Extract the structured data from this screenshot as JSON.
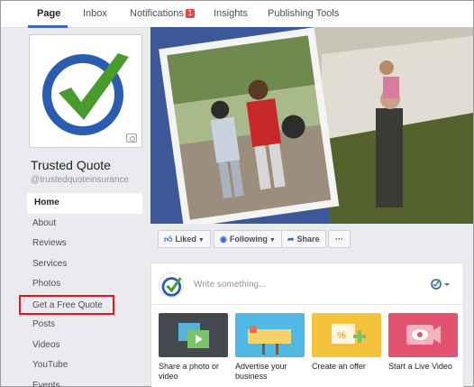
{
  "tabs": [
    {
      "label": "Page"
    },
    {
      "label": "Inbox"
    },
    {
      "label": "Notifications",
      "badge": "1"
    },
    {
      "label": "Insights"
    },
    {
      "label": "Publishing Tools"
    }
  ],
  "page": {
    "name": "Trusted Quote",
    "handle": "@trustedquoteinsurance"
  },
  "nav": [
    "Home",
    "About",
    "Reviews",
    "Services",
    "Photos",
    "Get a Free Quote",
    "Posts",
    "Videos",
    "YouTube",
    "Events"
  ],
  "actions": {
    "liked": "Liked",
    "following": "Following",
    "share": "Share",
    "more": "···"
  },
  "composer": {
    "placeholder": "Write something...",
    "tiles": [
      {
        "label": "Share a photo or video",
        "color": "#444950"
      },
      {
        "label": "Advertise your business",
        "color": "#4fb8e5"
      },
      {
        "label": "Create an offer",
        "color": "#f5c33b"
      },
      {
        "label": "Start a Live Video",
        "color": "#e2536f"
      }
    ]
  },
  "colors": {
    "accent": "#4267b2",
    "highlight_box": "#e8141c",
    "logo_blue": "#2a5db0",
    "logo_green": "#4a9a2e"
  }
}
